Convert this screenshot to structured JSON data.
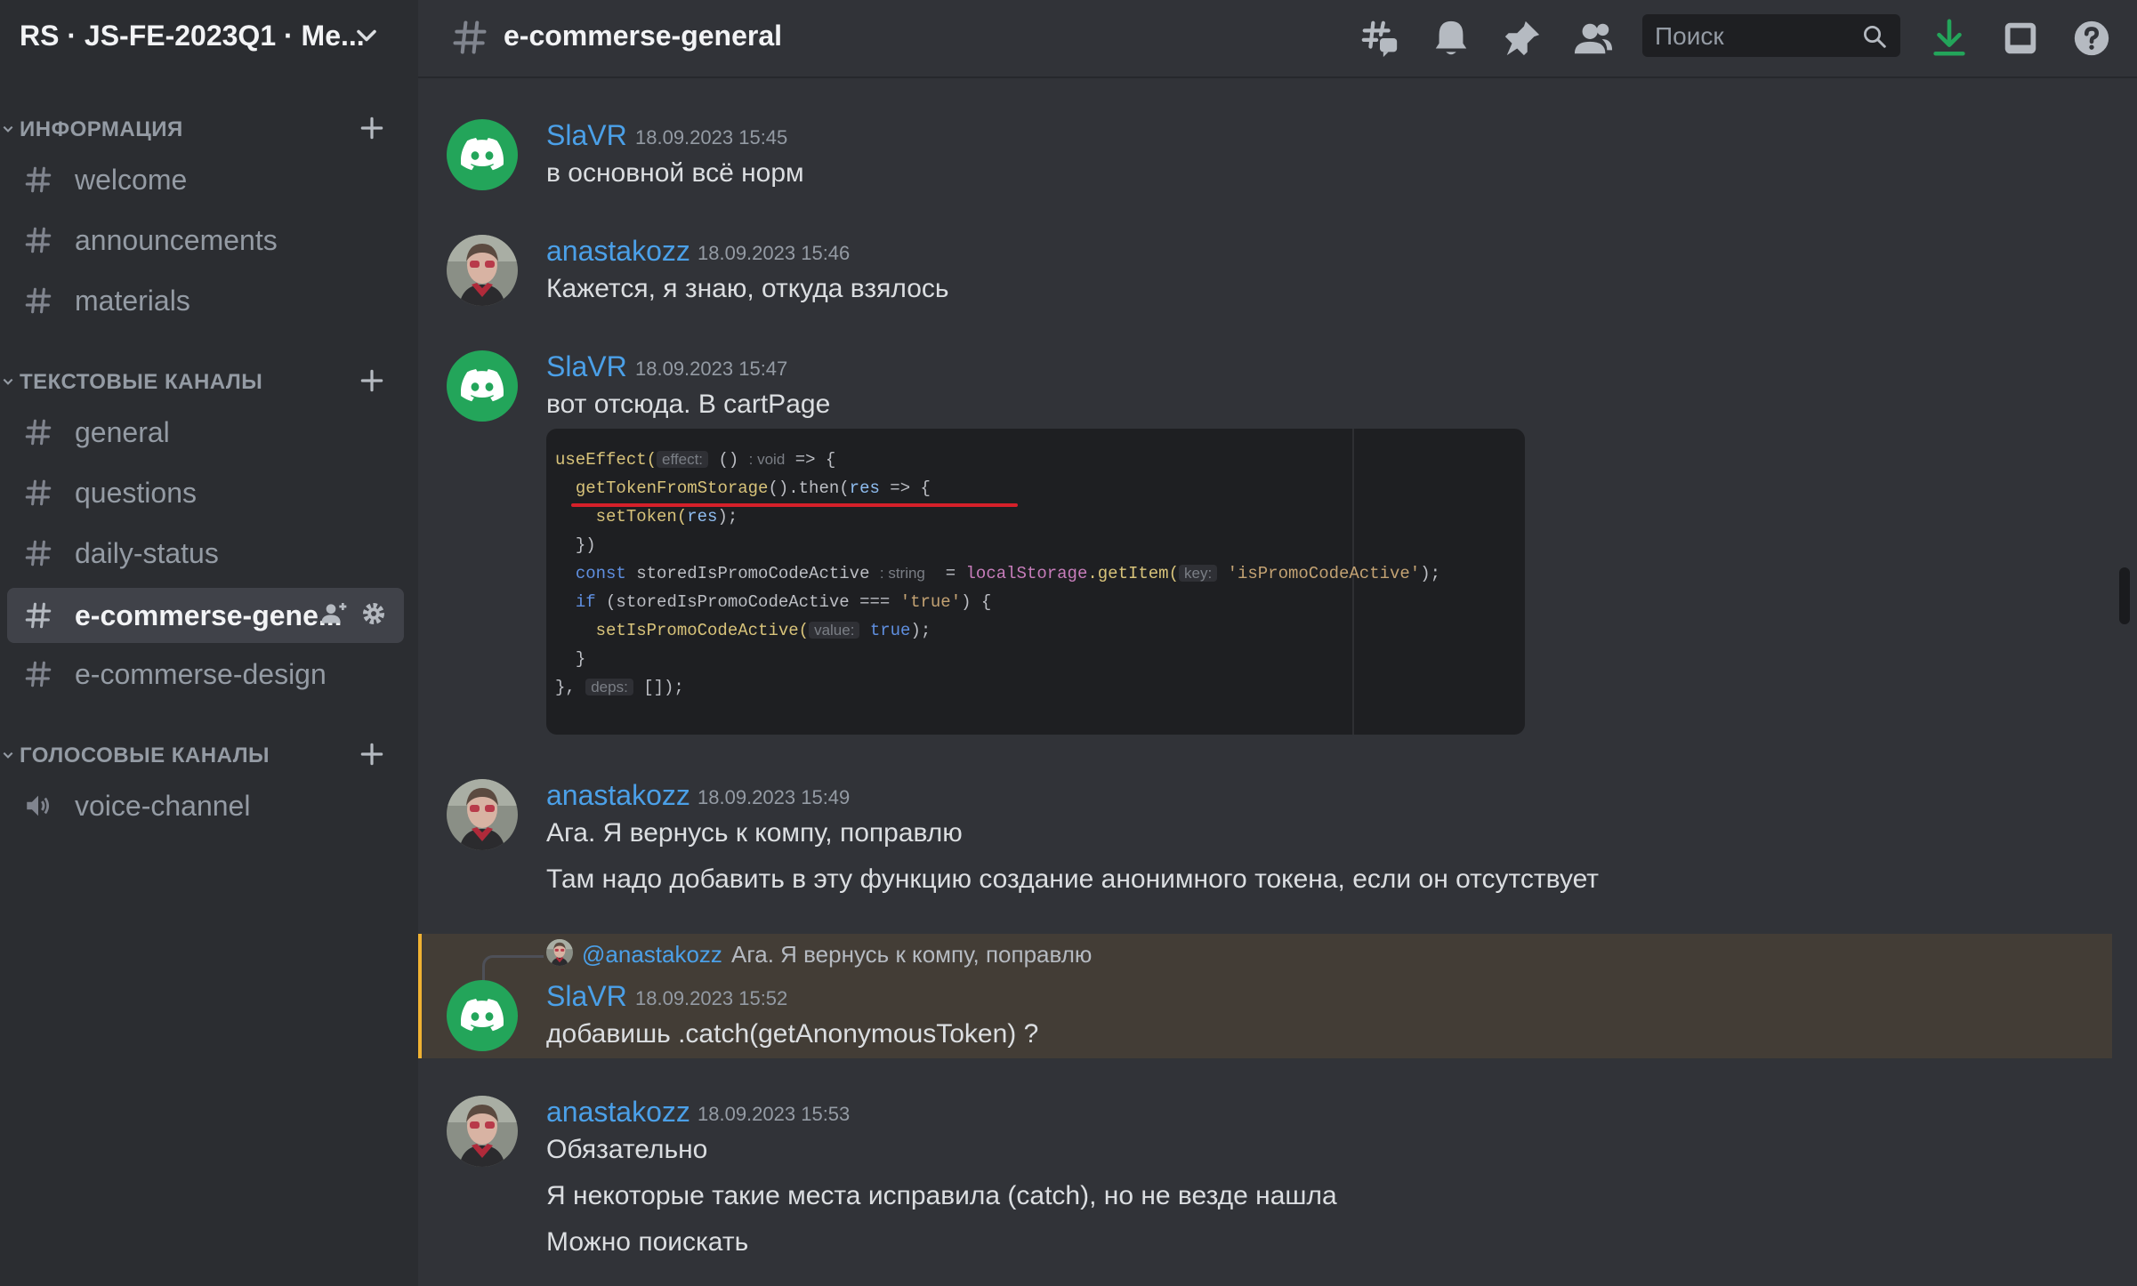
{
  "server": {
    "name": "RS · JS-FE-2023Q1 · Me..."
  },
  "sidebar": {
    "categories": [
      {
        "label": "ИНФОРМАЦИЯ",
        "channels": [
          {
            "label": "welcome"
          },
          {
            "label": "announcements"
          },
          {
            "label": "materials"
          }
        ]
      },
      {
        "label": "ТЕКСТОВЫЕ КАНАЛЫ",
        "channels": [
          {
            "label": "general"
          },
          {
            "label": "questions"
          },
          {
            "label": "daily-status"
          },
          {
            "label": "e-commerse-gene..."
          },
          {
            "label": "e-commerse-design"
          }
        ]
      },
      {
        "label": "ГОЛОСОВЫЕ КАНАЛЫ",
        "channels": [
          {
            "label": "voice-channel"
          }
        ]
      }
    ]
  },
  "header": {
    "channel_title": "e-commerse-general",
    "search_placeholder": "Поиск"
  },
  "messages": [
    {
      "author": "SlaVR",
      "timestamp": "18.09.2023 15:45",
      "lines": [
        "в основной всё норм"
      ]
    },
    {
      "author": "anastakozz",
      "timestamp": "18.09.2023 15:46",
      "lines": [
        "Кажется, я знаю, откуда взялось"
      ]
    },
    {
      "author": "SlaVR",
      "timestamp": "18.09.2023 15:47",
      "lines": [
        "вот отсюда. В cartPage"
      ]
    },
    {
      "author": "anastakozz",
      "timestamp": "18.09.2023 15:49",
      "lines": [
        "Ага. Я вернусь к компу, поправлю",
        "Там надо добавить в эту функцию создание анонимного токена, если он отсутствует"
      ]
    },
    {
      "author": "SlaVR",
      "timestamp": "18.09.2023 15:52",
      "lines": [
        "добавишь .catch(getAnonymousToken) ?"
      ],
      "reply": {
        "mention": "@anastakozz",
        "text": "Ага. Я вернусь к компу, поправлю"
      }
    },
    {
      "author": "anastakozz",
      "timestamp": "18.09.2023 15:53",
      "lines": [
        "Обязательно",
        "Я некоторые такие места исправила (catch), но не везде нашла",
        "Можно поискать"
      ]
    }
  ],
  "code": {
    "hints": {
      "effect": "effect:",
      "void": ": void",
      "string": ": string",
      "key": "key:",
      "value": "value:",
      "deps": "deps:"
    },
    "tokens": {
      "useEffect": "useEffect(",
      "arrow_open": "() ",
      "arrow_end": " => {",
      "getToken": "getTokenFromStorage",
      "then": "().then(",
      "res": "res",
      "then_end": " => {",
      "setToken": "setToken(",
      "setToken_end": ");",
      "close_then": "})",
      "const": "const",
      "var_name": " storedIsPromoCodeActive ",
      "eq": "= ",
      "localStorage": "localStorage",
      "getItem": ".getItem(",
      "key_str": "'isPromoCodeActive'",
      "getItem_end": ");",
      "if": "if",
      "if_cond": " (storedIsPromoCodeActive === ",
      "true_str": "'true'",
      "if_end": ") {",
      "setPromo": "setIsPromoCodeActive(",
      "true_kw": "true",
      "setPromo_end": ");",
      "close_if": "}",
      "close_effect": "}, ",
      "deps_end": "[]);"
    }
  },
  "colors": {
    "accent_author": "#4ba0e8",
    "highlight_bg": "#433d36",
    "highlight_border": "#f0b232",
    "bot_avatar": "#23a55a",
    "download": "#23a55a",
    "underline": "#d6202a"
  },
  "icons": [
    "chevron-down-icon",
    "plus-icon",
    "hash-icon",
    "speaker-icon",
    "add-member-icon",
    "gear-icon",
    "threads-icon",
    "bell-icon",
    "pin-icon",
    "members-icon",
    "search-icon",
    "download-icon",
    "inbox-icon",
    "help-icon",
    "discord-logo-icon"
  ]
}
